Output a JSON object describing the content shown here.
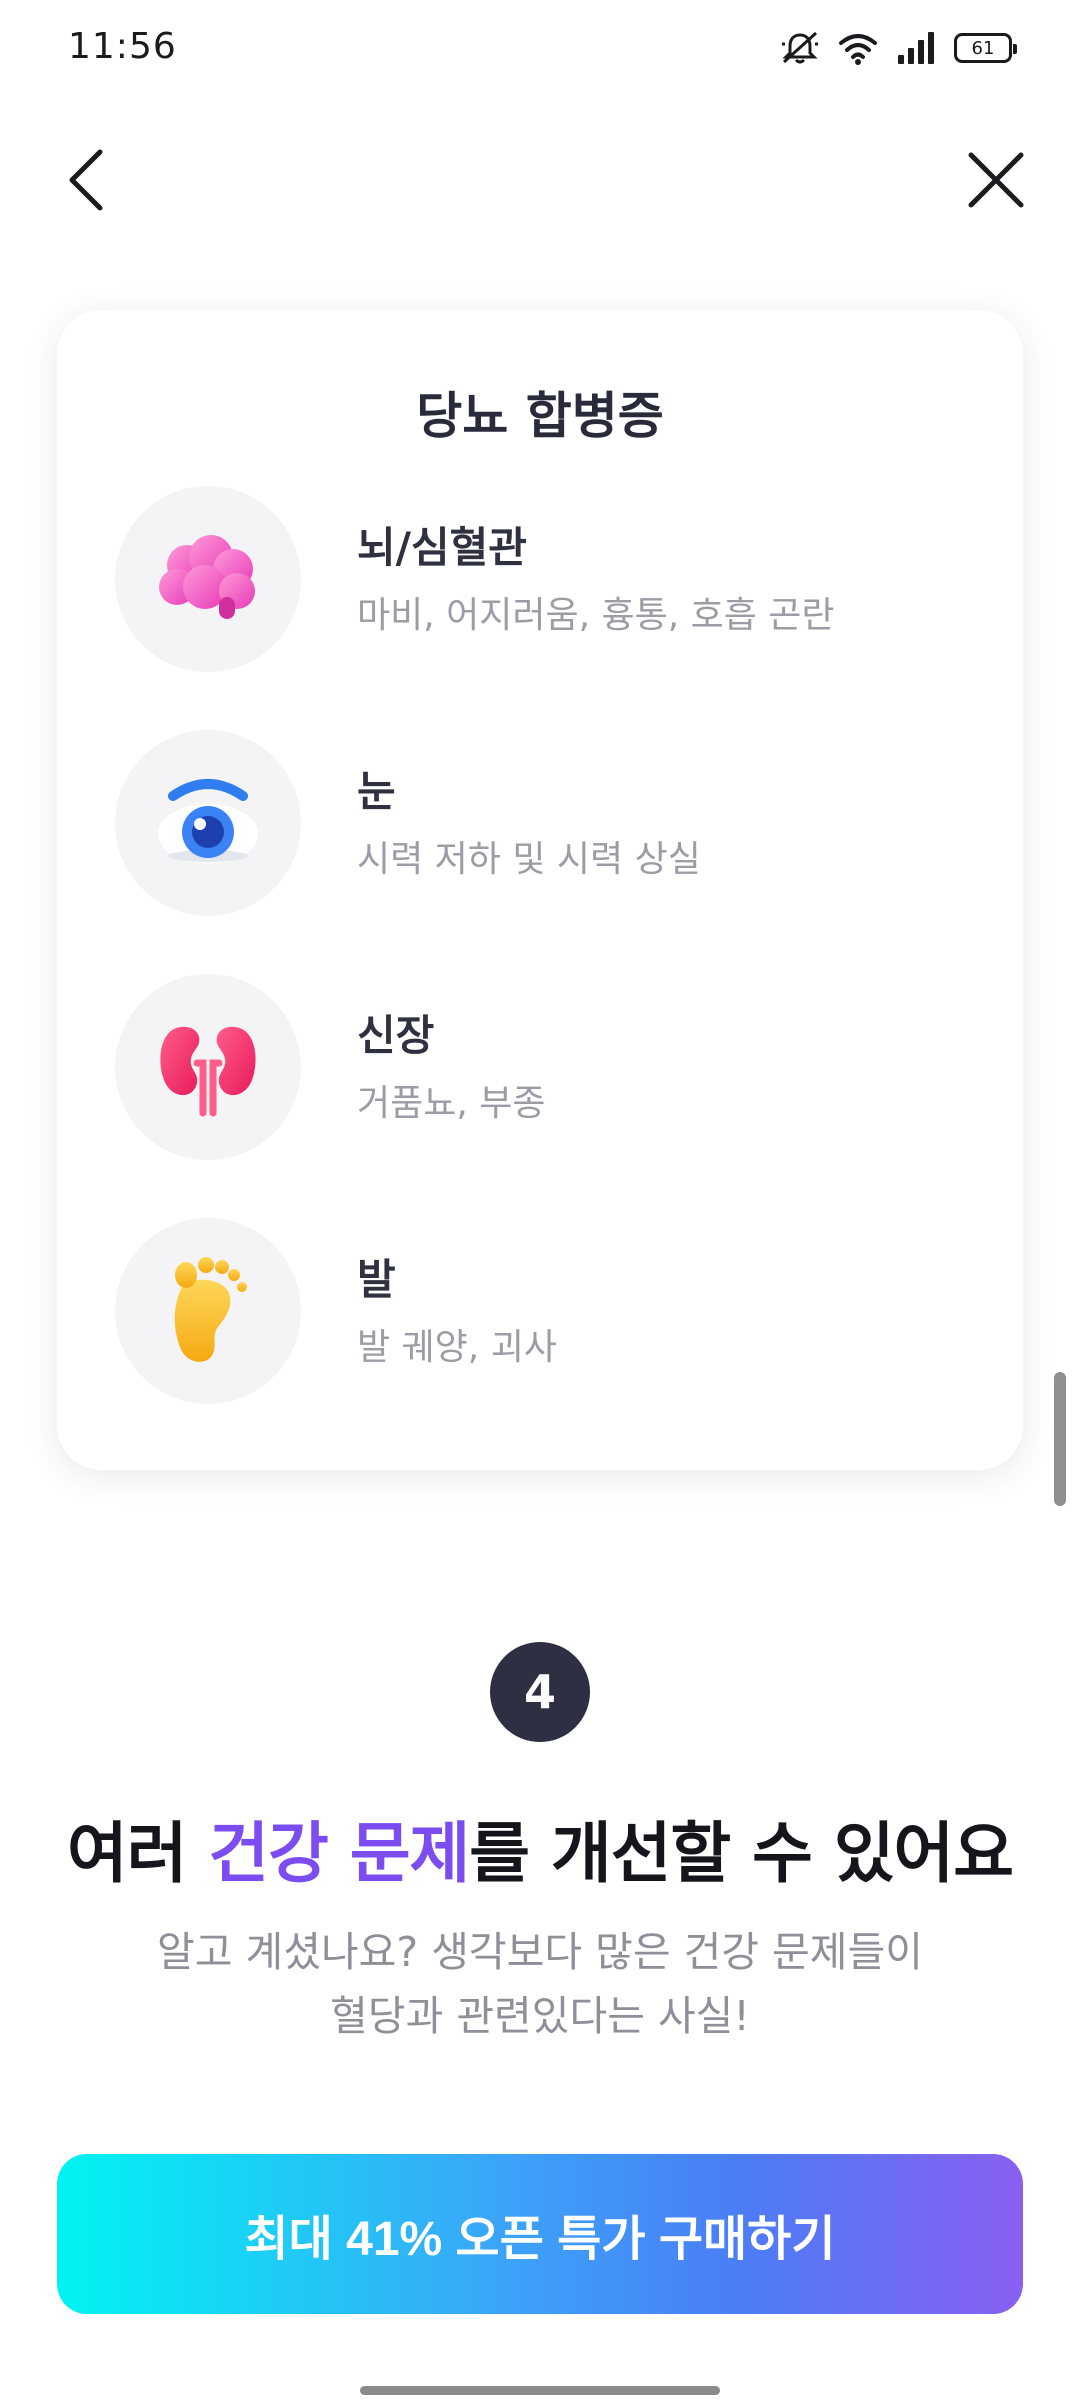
{
  "status_bar": {
    "time": "11:56",
    "battery_level": "61",
    "icons": [
      "mute-bell-icon",
      "wifi-icon",
      "signal-icon",
      "battery-icon"
    ]
  },
  "nav": {
    "back_icon": "chevron-left-icon",
    "close_icon": "close-icon"
  },
  "complications_card": {
    "title": "당뇨 합병증",
    "items": [
      {
        "name": "뇌/심혈관",
        "description": "마비, 어지러움, 흉통, 호흡 곤란",
        "icon": "brain-icon"
      },
      {
        "name": "눈",
        "description": "시력 저하 및 시력 상실",
        "icon": "eye-icon"
      },
      {
        "name": "신장",
        "description": "거품뇨, 부종",
        "icon": "kidney-icon"
      },
      {
        "name": "발",
        "description": "발 궤양, 괴사",
        "icon": "foot-icon"
      }
    ]
  },
  "step": {
    "number": "4",
    "headline_prefix": "여러 ",
    "headline_accent": "건강 문제",
    "headline_suffix": "를 개선할 수 있어요",
    "subtext_line1": "알고 계셨나요? 생각보다 많은 건강 문제들이",
    "subtext_line2": "혈당과 관련있다는 사실!"
  },
  "cta": {
    "label": "최대 41% 오픈 특가 구매하기"
  },
  "colors": {
    "accent_purple": "#7b4df0",
    "badge_dark": "#2e2f42",
    "cta_gradient_start": "#00f4f2",
    "cta_gradient_end": "#8a5ff2"
  }
}
